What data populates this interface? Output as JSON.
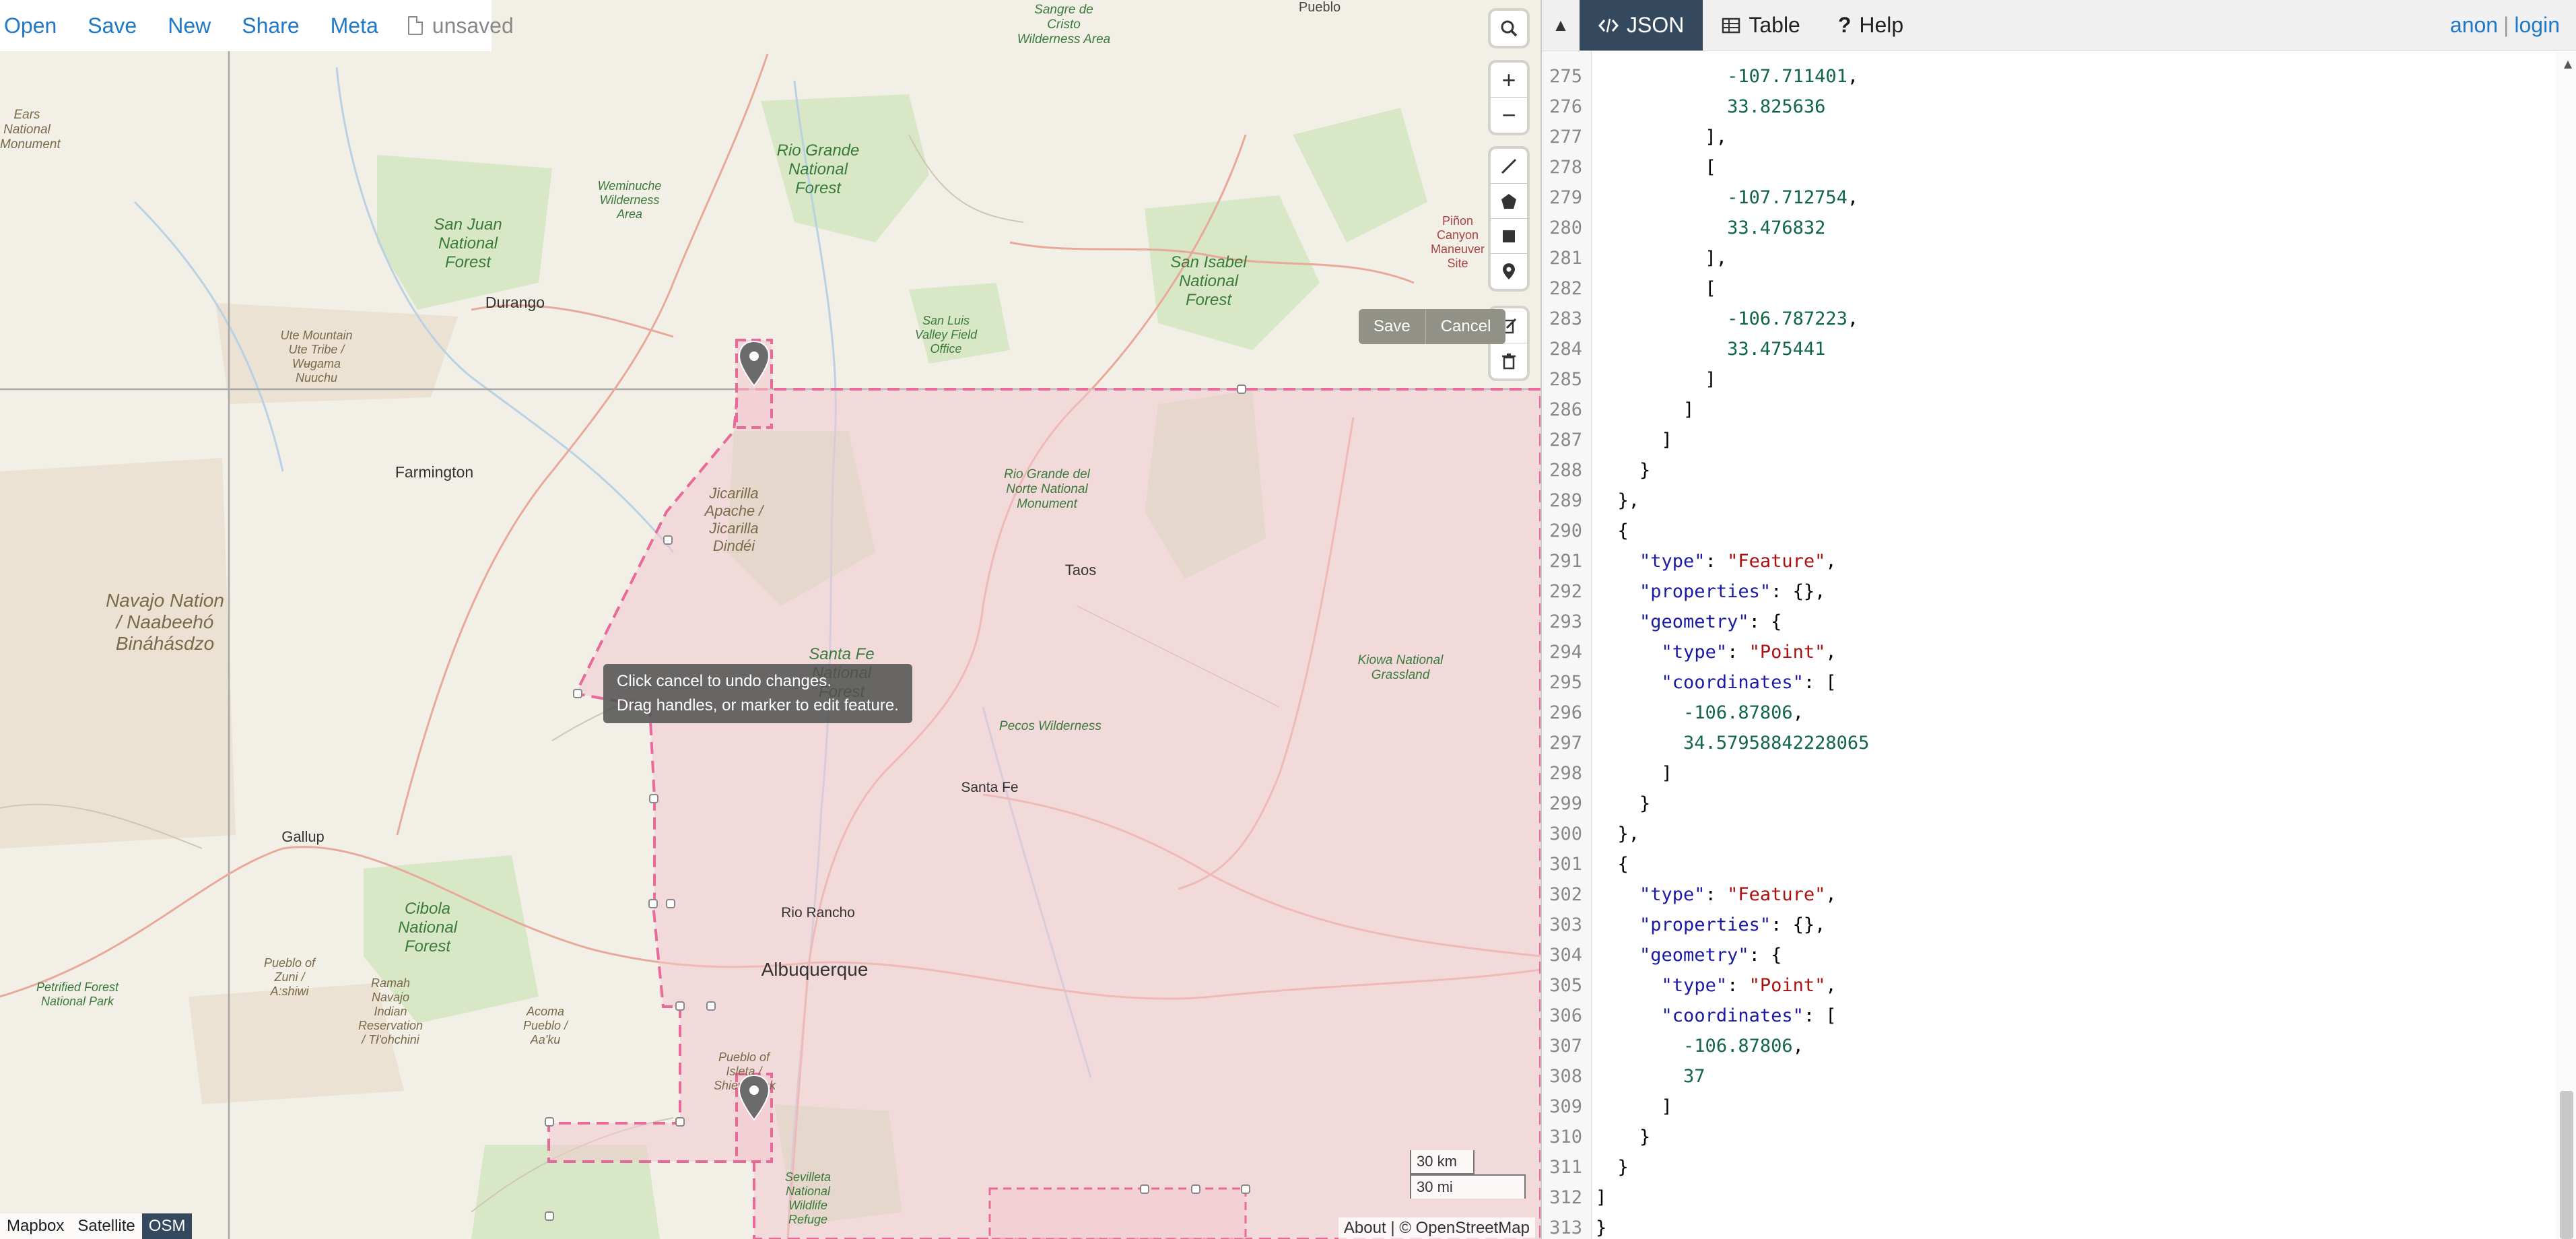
{
  "menu": {
    "items": [
      "Open",
      "Save",
      "New",
      "Share",
      "Meta"
    ],
    "status": "unsaved"
  },
  "map": {
    "edit_toolbar": {
      "save": "Save",
      "cancel": "Cancel"
    },
    "tooltip": {
      "line1": "Click cancel to undo changes.",
      "line2": "Drag handles, or marker to edit feature."
    },
    "scale": {
      "km": "30 km",
      "mi": "30 mi"
    },
    "layers": [
      "Mapbox",
      "Satellite",
      "OSM"
    ],
    "active_layer": "OSM",
    "attribution": {
      "about": "About",
      "credit": "| © OpenStreetMap"
    },
    "labels": [
      "Sangre de Cristo Wilderness Area",
      "Pueblo",
      "Rio Grande National Forest",
      "Weminuche Wilderness Area",
      "San Juan National Forest",
      "San Isabel National Forest",
      "Piñon Canyon Maneuver Site",
      "Durango",
      "San Luis Valley Field Office",
      "Ute Mountain Ute Tribe / Wʉgama Nuuchu",
      "Farmington",
      "Jicarilla Apache / Jicarilla Dindéi",
      "Rio Grande del Norte National Monument",
      "Taos",
      "Navajo Nation / Naabeehó Bináhásdzo",
      "Santa Fe National Forest",
      "Kiowa National Grassland",
      "Pecos Wilderness",
      "Santa Fe",
      "Gallup",
      "Rio Rancho",
      "Cibola National Forest",
      "Albuquerque",
      "Pueblo of Zuni / A:shiwi",
      "Ramah Navajo Indian Reservation / Tł'ohchini",
      "Petrified Forest National Park",
      "Acoma Pueblo / Aa'ku",
      "Pueblo of Isleta / Shiewhibak",
      "Sevilleta National Wildlife Refuge",
      "Ears National Monument"
    ]
  },
  "pane": {
    "tabs": [
      "JSON",
      "Table",
      "Help"
    ],
    "active_tab": "JSON",
    "user": "anon",
    "login": "login",
    "editor_lines": [
      {
        "n": "275",
        "t": "            -107.711401,"
      },
      {
        "n": "276",
        "t": "            33.825636"
      },
      {
        "n": "277",
        "t": "          ],"
      },
      {
        "n": "278",
        "t": "          ["
      },
      {
        "n": "279",
        "t": "            -107.712754,"
      },
      {
        "n": "280",
        "t": "            33.476832"
      },
      {
        "n": "281",
        "t": "          ],"
      },
      {
        "n": "282",
        "t": "          ["
      },
      {
        "n": "283",
        "t": "            -106.787223,"
      },
      {
        "n": "284",
        "t": "            33.475441"
      },
      {
        "n": "285",
        "t": "          ]"
      },
      {
        "n": "286",
        "t": "        ]"
      },
      {
        "n": "287",
        "t": "      ]"
      },
      {
        "n": "288",
        "t": "    }"
      },
      {
        "n": "289",
        "t": "  },"
      },
      {
        "n": "290",
        "t": "  {"
      },
      {
        "n": "291",
        "t": "    \"type\": \"Feature\","
      },
      {
        "n": "292",
        "t": "    \"properties\": {},"
      },
      {
        "n": "293",
        "t": "    \"geometry\": {"
      },
      {
        "n": "294",
        "t": "      \"type\": \"Point\","
      },
      {
        "n": "295",
        "t": "      \"coordinates\": ["
      },
      {
        "n": "296",
        "t": "        -106.87806,"
      },
      {
        "n": "297",
        "t": "        34.57958842228065"
      },
      {
        "n": "298",
        "t": "      ]"
      },
      {
        "n": "299",
        "t": "    }"
      },
      {
        "n": "300",
        "t": "  },"
      },
      {
        "n": "301",
        "t": "  {"
      },
      {
        "n": "302",
        "t": "    \"type\": \"Feature\","
      },
      {
        "n": "303",
        "t": "    \"properties\": {},"
      },
      {
        "n": "304",
        "t": "    \"geometry\": {"
      },
      {
        "n": "305",
        "t": "      \"type\": \"Point\","
      },
      {
        "n": "306",
        "t": "      \"coordinates\": ["
      },
      {
        "n": "307",
        "t": "        -106.87806,"
      },
      {
        "n": "308",
        "t": "        37"
      },
      {
        "n": "309",
        "t": "      ]"
      },
      {
        "n": "310",
        "t": "    }"
      },
      {
        "n": "311",
        "t": "  }"
      },
      {
        "n": "312",
        "t": "]"
      },
      {
        "n": "313",
        "t": "}"
      }
    ]
  },
  "colors": {
    "link": "#1f78c8",
    "active_tab": "#34495e",
    "selection_fill": "#f2c9cf",
    "selection_stroke": "#e8699a",
    "marker": "#6b6b6b",
    "map_bg": "#f2efe6"
  },
  "icons": {
    "map_controls": [
      "search-icon",
      "zoom-in-icon",
      "zoom-out-icon",
      "draw-line-icon",
      "draw-polygon-icon",
      "draw-rectangle-icon",
      "draw-marker-icon",
      "edit-layers-icon",
      "delete-layers-icon"
    ],
    "tabs": [
      "code-icon",
      "table-icon",
      "help-icon"
    ]
  }
}
